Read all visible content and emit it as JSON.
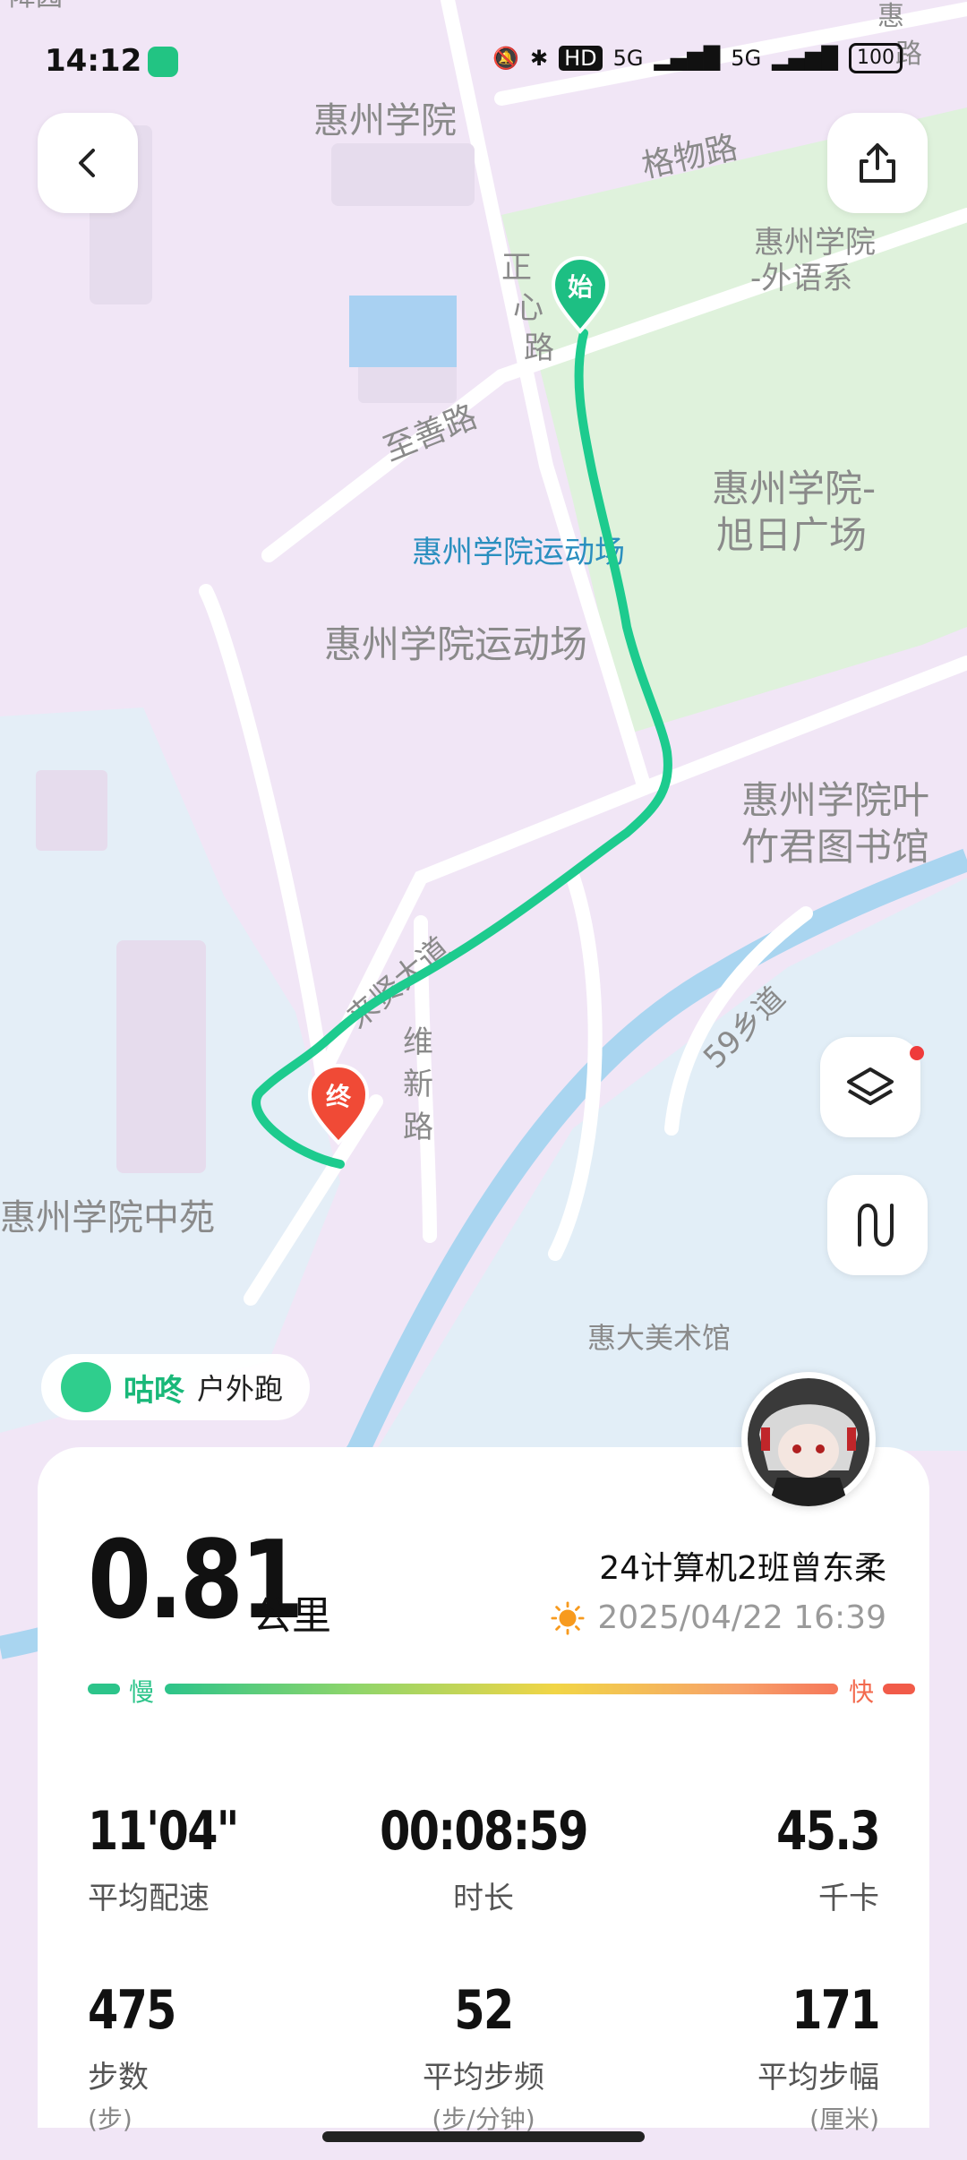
{
  "status": {
    "time": "14:12",
    "hd": "HD",
    "net1": "5G",
    "net2": "5G",
    "battery": "100"
  },
  "map": {
    "labels": {
      "campus": "惠州学院",
      "gewu": "格物路",
      "waiyu": "惠州学院\n-外语系",
      "zhengxin": "正\n心\n路",
      "zhishan": "至善路",
      "xuri": "惠州学院-\n旭日广场",
      "sport_blue": "惠州学院运动场",
      "sport_gray": "惠州学院运动场",
      "library": "惠州学院叶\n竹君图书馆",
      "road59": "59乡道",
      "weixin": "维\n新\n路",
      "laixian": "来贤大道",
      "zhongyuan": "惠州学院中苑",
      "art": "惠大美术馆",
      "top_right": "惠\n路",
      "top_left": "降园"
    },
    "markers": {
      "start": "始",
      "end": "终"
    },
    "colors": {
      "route": "#1dcb8e",
      "start": "#1dbf83",
      "end": "#f04a36"
    }
  },
  "brand": {
    "name": "咕咚",
    "mode": "户外跑"
  },
  "summary": {
    "distance": "0.81",
    "unit": "公里",
    "user": "24计算机2班曾东柔",
    "datetime": "2025/04/22 16:39"
  },
  "pace_bar": {
    "slow": "慢",
    "fast": "快"
  },
  "stats": [
    {
      "value": "11'04\"",
      "label": "平均配速",
      "unit": ""
    },
    {
      "value": "00:08:59",
      "label": "时长",
      "unit": ""
    },
    {
      "value": "45.3",
      "label": "千卡",
      "unit": ""
    },
    {
      "value": "475",
      "label": "步数",
      "unit": "(步)"
    },
    {
      "value": "52",
      "label": "平均步频",
      "unit": "(步/分钟)"
    },
    {
      "value": "171",
      "label": "平均步幅",
      "unit": "(厘米)"
    }
  ]
}
